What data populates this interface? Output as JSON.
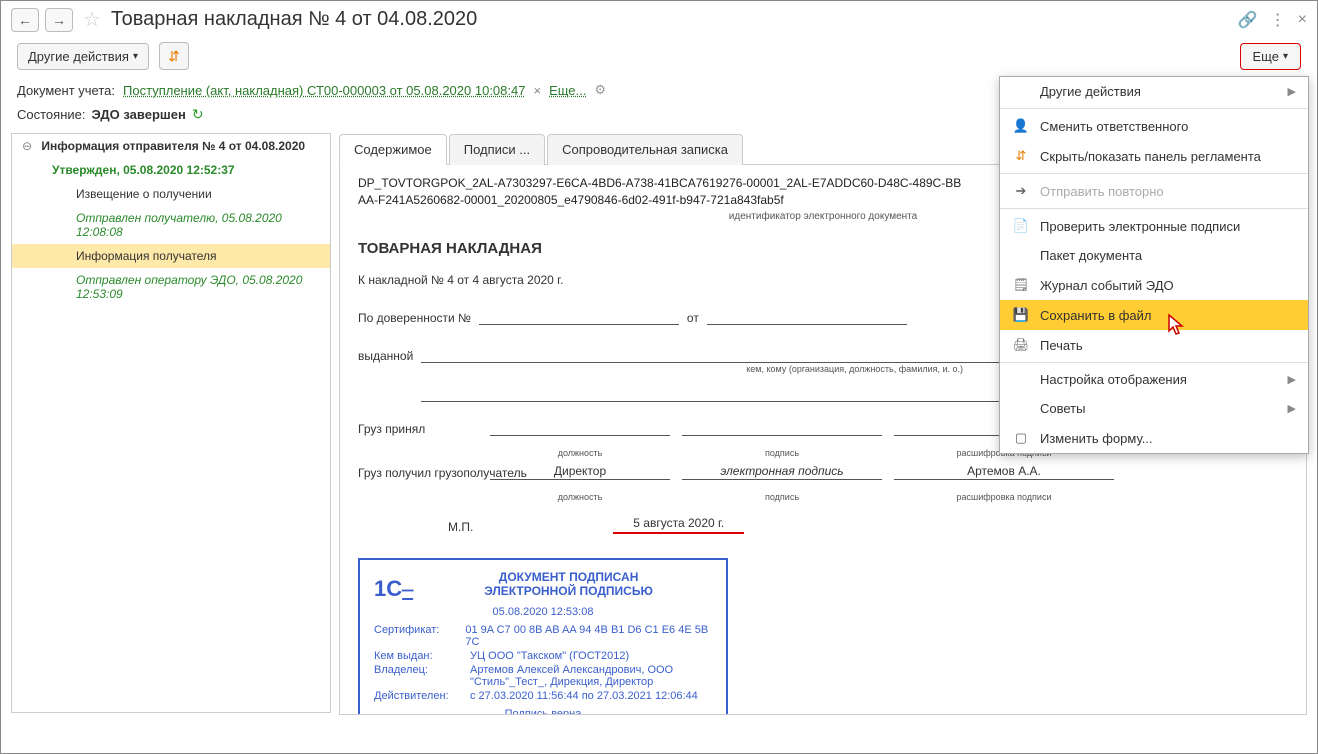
{
  "title": "Товарная накладная № 4 от 04.08.2020",
  "toolbar": {
    "other_actions": "Другие действия",
    "more": "Еще"
  },
  "doc_link": {
    "label": "Документ учета:",
    "link": "Поступление (акт, накладная) СТ00-000003 от 05.08.2020 10:08:47",
    "more": "Еще..."
  },
  "state": {
    "label": "Состояние:",
    "value": "ЭДО завершен"
  },
  "tree": {
    "root": "Информация отправителя № 4 от 04.08.2020",
    "approved": "Утвержден, 05.08.2020 12:52:37",
    "notice": "Извещение о получении",
    "sent_recipient": "Отправлен получателю, 05.08.2020 12:08:08",
    "recipient_info": "Информация получателя",
    "sent_operator": "Отправлен оператору ЭДО, 05.08.2020 12:53:09"
  },
  "tabs": {
    "content": "Содержимое",
    "signatures": "Подписи ...",
    "cover_note": "Сопроводительная записка"
  },
  "doc": {
    "id_line1": "DP_TOVTORGPOK_2AL-A7303297-E6CA-4BD6-A738-41BCA7619276-00001_2AL-E7ADDC60-D48C-489C-BB",
    "id_line2": "AA-F241A5260682-00001_20200805_e4790846-6d02-491f-b947-721a843fab5f",
    "id_sub": "идентификатор электронного документа",
    "title": "ТОВАРНАЯ НАКЛАДНАЯ",
    "subtitle": "К накладной № 4 от 4 августа 2020 г.",
    "proxy_label": "По доверенности №",
    "from_label": "от",
    "issued_label": "выданной",
    "issued_hint": "кем, кому (организация, должность, фамилия, и. о.)",
    "cargo_accepted": "Груз принял",
    "cargo_received": "Груз получил грузополучатель",
    "col_position": "должность",
    "col_signature": "подпись",
    "col_decrypt": "расшифровка подписи",
    "position_val": "Директор",
    "signature_val": "электронная подпись",
    "name_val": "Артемов А.А.",
    "mp": "М.П.",
    "date": "5 августа 2020 г."
  },
  "stamp": {
    "head1": "ДОКУМЕНТ ПОДПИСАН",
    "head2": "ЭЛЕКТРОННОЙ ПОДПИСЬЮ",
    "date": "05.08.2020 12:53:08",
    "cert_label": "Сертификат:",
    "cert": "01 9A C7 00 8B AB AA 94 4B B1 D6 C1 E6 4E 5B 7C",
    "issuer_label": "Кем выдан:",
    "issuer": "УЦ ООО \"Такском\" (ГОСТ2012)",
    "owner_label": "Владелец:",
    "owner": "Артемов Алексей Александрович, ООО \"Стиль\"_Тест_, Дирекция, Директор",
    "valid_label": "Действителен:",
    "valid": "с 27.03.2020 11:56:44 по 27.03.2021 12:06:44",
    "verif": "Подпись верна",
    "logo": "1C"
  },
  "menu": {
    "other_actions": "Другие действия",
    "change_responsible": "Сменить ответственного",
    "toggle_panel": "Скрыть/показать панель регламента",
    "resend": "Отправить повторно",
    "check_sig": "Проверить электронные подписи",
    "package": "Пакет документа",
    "log": "Журнал событий ЭДО",
    "save_file": "Сохранить в файл",
    "print": "Печать",
    "display_settings": "Настройка отображения",
    "tips": "Советы",
    "change_form": "Изменить форму..."
  }
}
